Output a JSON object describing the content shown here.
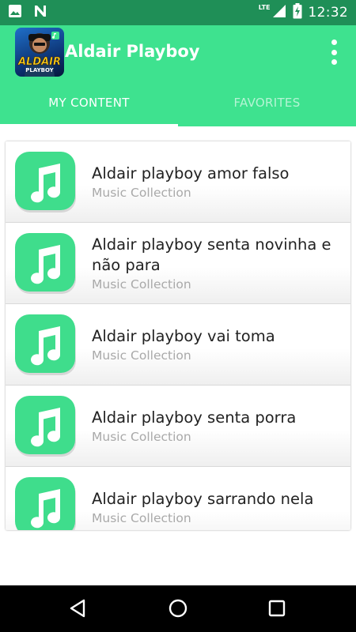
{
  "status_bar": {
    "time": "12:32",
    "network": "LTE",
    "icons": [
      "image-icon",
      "n-icon",
      "signal-icon",
      "battery-charging-icon"
    ]
  },
  "app": {
    "title": "Aldair Playboy",
    "logo": {
      "icon": "artist-avatar-icon",
      "text_main": "ALDAIR",
      "text_sub": "PLAYBOY"
    },
    "menu_icon": "more-vert-icon"
  },
  "tabs": [
    {
      "label": "MY CONTENT",
      "selected": true
    },
    {
      "label": "FAVORITES",
      "selected": false
    }
  ],
  "songs": [
    {
      "title": "Aldair playboy amor falso",
      "subtitle": "Music Collection"
    },
    {
      "title": "Aldair playboy senta novinha e não para",
      "subtitle": "Music Collection"
    },
    {
      "title": "Aldair playboy vai toma",
      "subtitle": "Music Collection"
    },
    {
      "title": "Aldair playboy senta porra",
      "subtitle": "Music Collection"
    },
    {
      "title": "Aldair playboy sarrando nela",
      "subtitle": "Music Collection"
    }
  ],
  "item_icon": "music-note-icon",
  "nav": [
    "back-icon",
    "home-icon",
    "recents-icon"
  ],
  "colors": {
    "accent": "#3ee28f",
    "status_bar": "#1f8f57",
    "icon_green": "#3fdd8c"
  }
}
